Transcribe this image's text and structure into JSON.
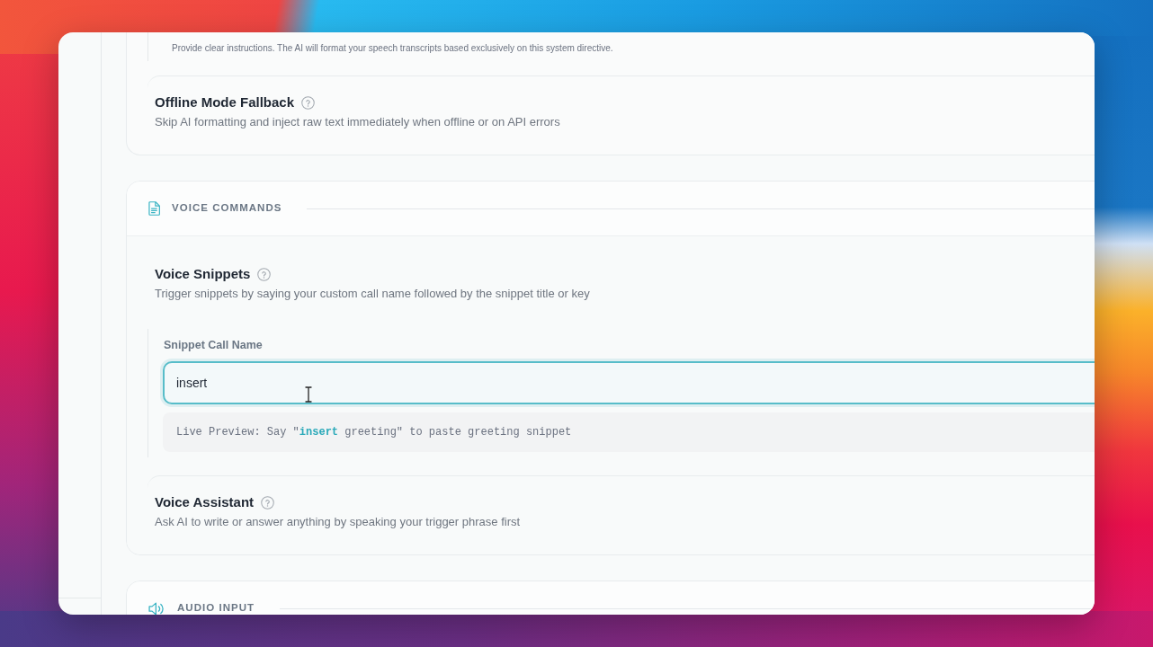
{
  "cards": [
    {
      "items": [
        {
          "kind": "note",
          "text": "Provide clear instructions. The AI will format your speech transcripts based exclusively on this system directive."
        },
        {
          "kind": "setting",
          "title": "Offline Mode Fallback",
          "description": "Skip AI formatting and inject raw text immediately when offline or on API errors"
        }
      ]
    },
    {
      "title": "VOICE COMMANDS",
      "items": [
        {
          "kind": "setting",
          "title": "Voice Snippets",
          "description": "Trigger snippets by saying your custom call name followed by the snippet title or key"
        },
        {
          "kind": "field",
          "label": "Snippet Call Name",
          "value": "insert",
          "focused": true,
          "preview": "Live Preview: Say \"**insert** greeting\" to paste greeting snippet"
        },
        {
          "kind": "setting",
          "title": "Voice Assistant",
          "description": "Ask AI to write or answer anything by speaking your trigger phrase first"
        }
      ]
    },
    {
      "title": "AUDIO INPUT"
    }
  ]
}
